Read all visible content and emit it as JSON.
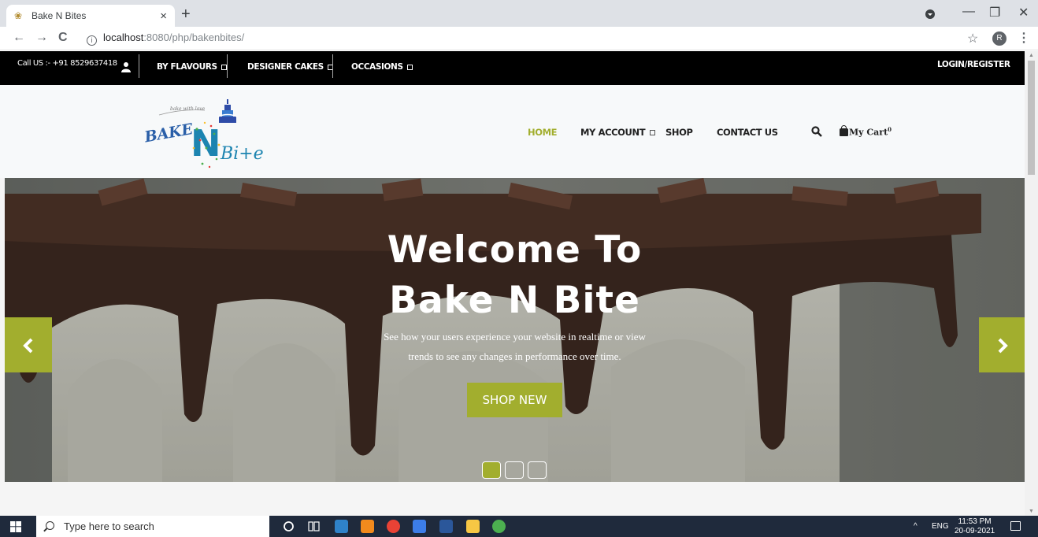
{
  "browser": {
    "tab_title": "Bake N Bites",
    "tab_close": "×",
    "new_tab": "+",
    "url_host": "localhost",
    "url_path": ":8080/php/bakenbites/",
    "profile_initial": "R",
    "back": "←",
    "forward": "→",
    "reload": "C",
    "star": "☆",
    "menu": "⋮",
    "minimize": "—",
    "maximize": "❐",
    "close": "✕"
  },
  "topbar": {
    "call": "Call US :- +91 8529637418",
    "menus": [
      "BY FLAVOURS",
      "DESIGNER CAKES",
      "OCCASIONS"
    ],
    "login": "LOGIN/REGISTER"
  },
  "nav": {
    "home": "HOME",
    "account": "MY ACCOUNT",
    "shop": "SHOP",
    "contact": "CONTACT US",
    "cart_label": "My Cart",
    "cart_count": "0"
  },
  "logo": {
    "word1": "BAKE",
    "word2": "N",
    "word3": "Bi+e",
    "tagline": "bake with love"
  },
  "hero": {
    "title_line1": "Welcome To",
    "title_line2": "Bake N Bite",
    "subtitle_line1": "See how your users experience your website in realtime or view",
    "subtitle_line2": "trends to see any changes in performance over time.",
    "cta": "SHOP NEW",
    "prev": "‹",
    "next": "›",
    "slide_count": 3,
    "active_slide": 1,
    "accent_color": "#a2ae2e"
  },
  "taskbar": {
    "search_placeholder": "Type here to search",
    "lang": "ENG",
    "time": "11:53 PM",
    "date": "20-09-2021",
    "tray_chevron": "^"
  }
}
